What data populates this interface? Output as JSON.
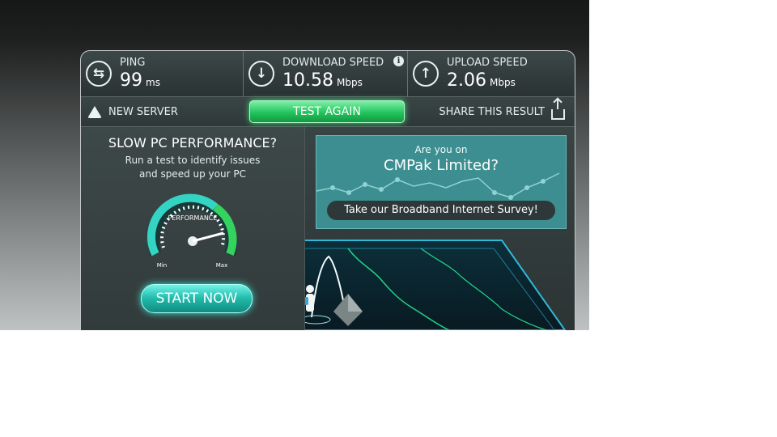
{
  "stats": {
    "ping": {
      "label": "PING",
      "value": "99",
      "unit": "ms",
      "icon": "ping-arrows-icon"
    },
    "download": {
      "label": "DOWNLOAD SPEED",
      "value": "10.58",
      "unit": "Mbps",
      "icon": "download-arrow-icon",
      "info_icon": "info-icon",
      "info_glyph": "i"
    },
    "upload": {
      "label": "UPLOAD SPEED",
      "value": "2.06",
      "unit": "Mbps",
      "icon": "upload-arrow-icon"
    }
  },
  "actions": {
    "new_server": "NEW SERVER",
    "test_again": "TEST AGAIN",
    "share": "SHARE THIS RESULT"
  },
  "promo": {
    "title": "SLOW PC PERFORMANCE?",
    "description": "Run a test to identify issues\nand speed up your PC",
    "gauge_label": "PERFORMANCE",
    "gauge_min": "Min",
    "gauge_max": "Max",
    "button": "START NOW"
  },
  "survey": {
    "prefix": "Are you on",
    "isp": "CMPak Limited?",
    "cta": "Take our Broadband Internet Survey!"
  },
  "colors": {
    "accent_green": "#22c45c",
    "accent_teal": "#20b9aa",
    "survey_bg": "#3c8e90",
    "panel_dark": "#2e3838"
  }
}
